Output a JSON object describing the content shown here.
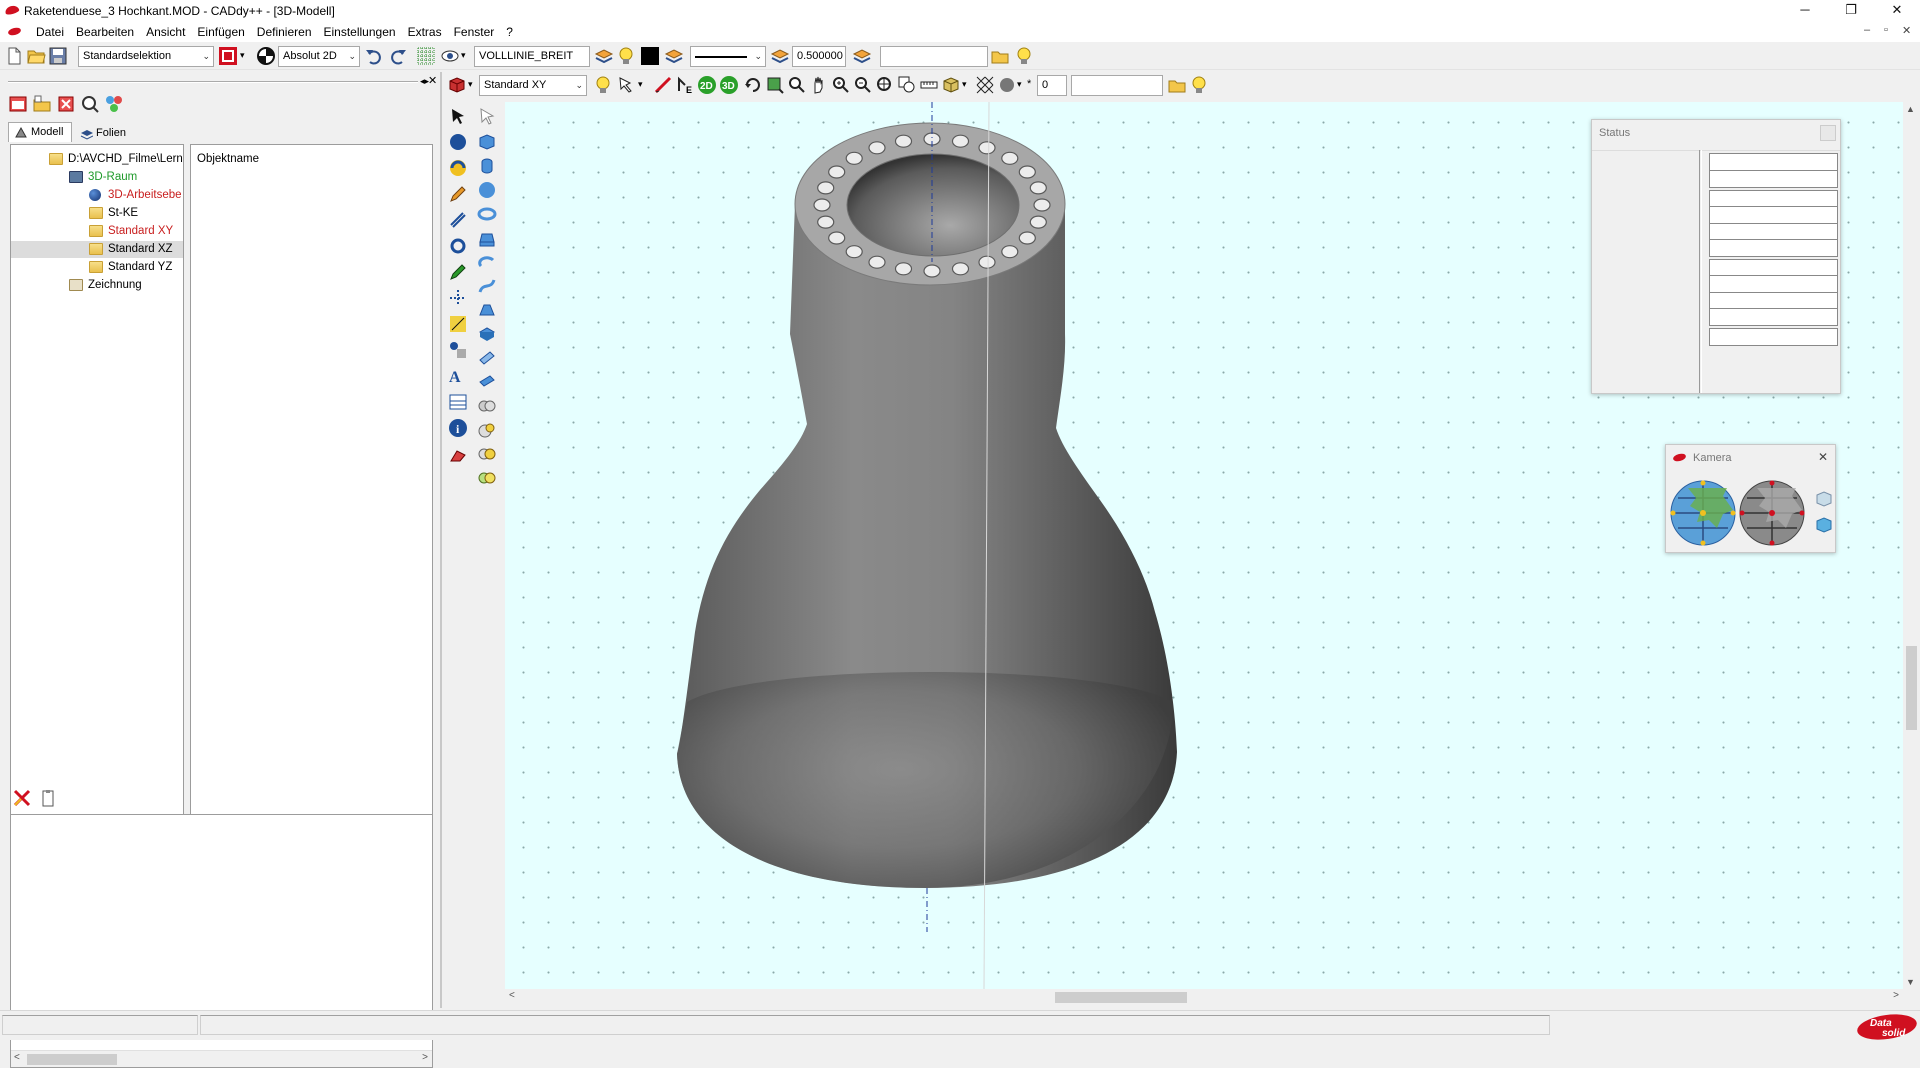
{
  "window": {
    "title": "Raketenduese_3 Hochkant.MOD  -  CADdy++ - [3D-Modell]",
    "minimize": "─",
    "restore": "❐",
    "close": "✕",
    "mdi_minimize": "–",
    "mdi_restore": "▫",
    "mdi_close": "✕"
  },
  "menu": [
    "Datei",
    "Bearbeiten",
    "Ansicht",
    "Einfügen",
    "Definieren",
    "Einstellungen",
    "Extras",
    "Fenster",
    "?"
  ],
  "toolbar1": {
    "selection_mode": "Standardselektion",
    "coord_mode": "Absolut 2D",
    "linetype": "VOLLLINIE_BREIT",
    "line_width": "0.500000",
    "extra_field": ""
  },
  "toolbar2": {
    "view_plane": "Standard XY",
    "mode_2d": "2D",
    "mode_3d": "3D",
    "number_value": "0",
    "extra_field": "",
    "star": "*"
  },
  "left_panel": {
    "tabs": [
      "Modell",
      "Folien"
    ],
    "tree": [
      {
        "label": "D:\\AVCHD_Filme\\Lern",
        "color": "#000000",
        "icon": "folder-icon",
        "level": 0
      },
      {
        "label": "3D-Raum",
        "color": "#1f9a2a",
        "icon": "3d-space-icon",
        "level": 1
      },
      {
        "label": "3D-Arbeitsebe",
        "color": "#c81e1e",
        "icon": "globe-icon",
        "level": 2
      },
      {
        "label": "St-KE",
        "color": "#000000",
        "icon": "folder-icon",
        "level": 2
      },
      {
        "label": "Standard XY",
        "color": "#c81e1e",
        "icon": "folder-icon",
        "level": 2
      },
      {
        "label": "Standard XZ",
        "color": "#000000",
        "icon": "folder-icon",
        "level": 2,
        "selected": true
      },
      {
        "label": "Standard YZ",
        "color": "#000000",
        "icon": "folder-icon",
        "level": 2
      },
      {
        "label": "Zeichnung",
        "color": "#000000",
        "icon": "drawing-icon",
        "level": 1
      }
    ],
    "object_header": "Objektname"
  },
  "status_window": {
    "title": "Status",
    "rows": 11
  },
  "camera_window": {
    "title": "Kamera",
    "close": "✕"
  },
  "scroll_arrows": {
    "left": "<",
    "right": ">",
    "up": "▲",
    "down": "▼"
  },
  "colors": {
    "viewport_bg": "#e6ffff",
    "model_gray": "#6e6e6e",
    "brand_red": "#d01020",
    "tree_red": "#c81e1e",
    "tree_green": "#1f9a2a",
    "selection_bg": "#dcdcdc"
  },
  "brand": {
    "logo_line1": "Data",
    "logo_line2": "solid"
  }
}
